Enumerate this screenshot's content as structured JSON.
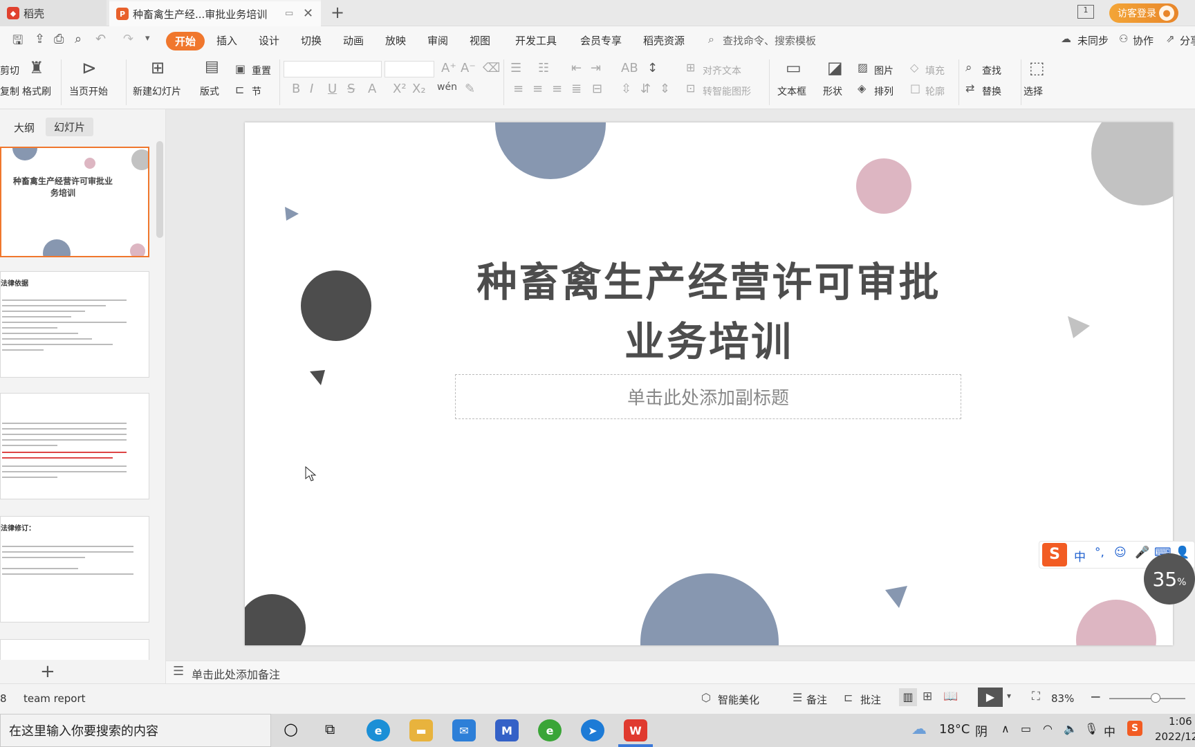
{
  "tabs": {
    "home_label": "稻壳",
    "doc_label": "种畜禽生产经...审批业务培训",
    "login_label": "访客登录",
    "notification_count": "1"
  },
  "menu": {
    "items": [
      "开始",
      "插入",
      "设计",
      "切换",
      "动画",
      "放映",
      "审阅",
      "视图",
      "开发工具",
      "会员专享",
      "稻壳资源"
    ],
    "search_placeholder": "查找命令、搜索模板",
    "sync_label": "未同步",
    "collab_label": "协作",
    "share_label": "分享"
  },
  "ribbon": {
    "cut": "剪切",
    "copy": "复制",
    "format_painter": "格式刷",
    "from_current": "当页开始",
    "new_slide": "新建幻灯片",
    "layout": "版式",
    "reset": "重置",
    "section": "节",
    "align_text": "对齐文本",
    "to_smartart": "转智能图形",
    "textbox": "文本框",
    "shape": "形状",
    "picture": "图片",
    "arrange": "排列",
    "fill": "填充",
    "outline": "轮廓",
    "find": "查找",
    "replace": "替换",
    "select": "选择"
  },
  "leftpanel": {
    "outline_tab": "大纲",
    "slides_tab": "幻灯片",
    "thumb1_title": "种畜禽生产经营许可审批业务培训",
    "thumb2_title": "法律依据",
    "thumb4_title": "法律修订："
  },
  "slide": {
    "title_line1": "种畜禽生产经营许可审批",
    "title_line2": "业务培训",
    "subtitle_placeholder": "单击此处添加副标题"
  },
  "notes_placeholder": "单击此处添加备注",
  "status": {
    "slide_count": "8",
    "theme": "team report",
    "smart_beautify": "智能美化",
    "notes": "备注",
    "comments": "批注",
    "zoom": "83%"
  },
  "ime": {
    "mode": "中",
    "progress": "35",
    "progress_unit": "%"
  },
  "taskbar": {
    "search_placeholder": "在这里输入你要搜索的内容",
    "weather_temp": "18°C",
    "weather_desc": "阴",
    "ime_lang": "中",
    "time": "1:06",
    "date": "2022/12"
  },
  "colors": {
    "accent": "#f0772d",
    "slide_blue": "#8797b0",
    "slide_pink": "#ddb6c2",
    "slide_dark": "#4d4d4d",
    "slide_gray": "#c2c2c2"
  }
}
